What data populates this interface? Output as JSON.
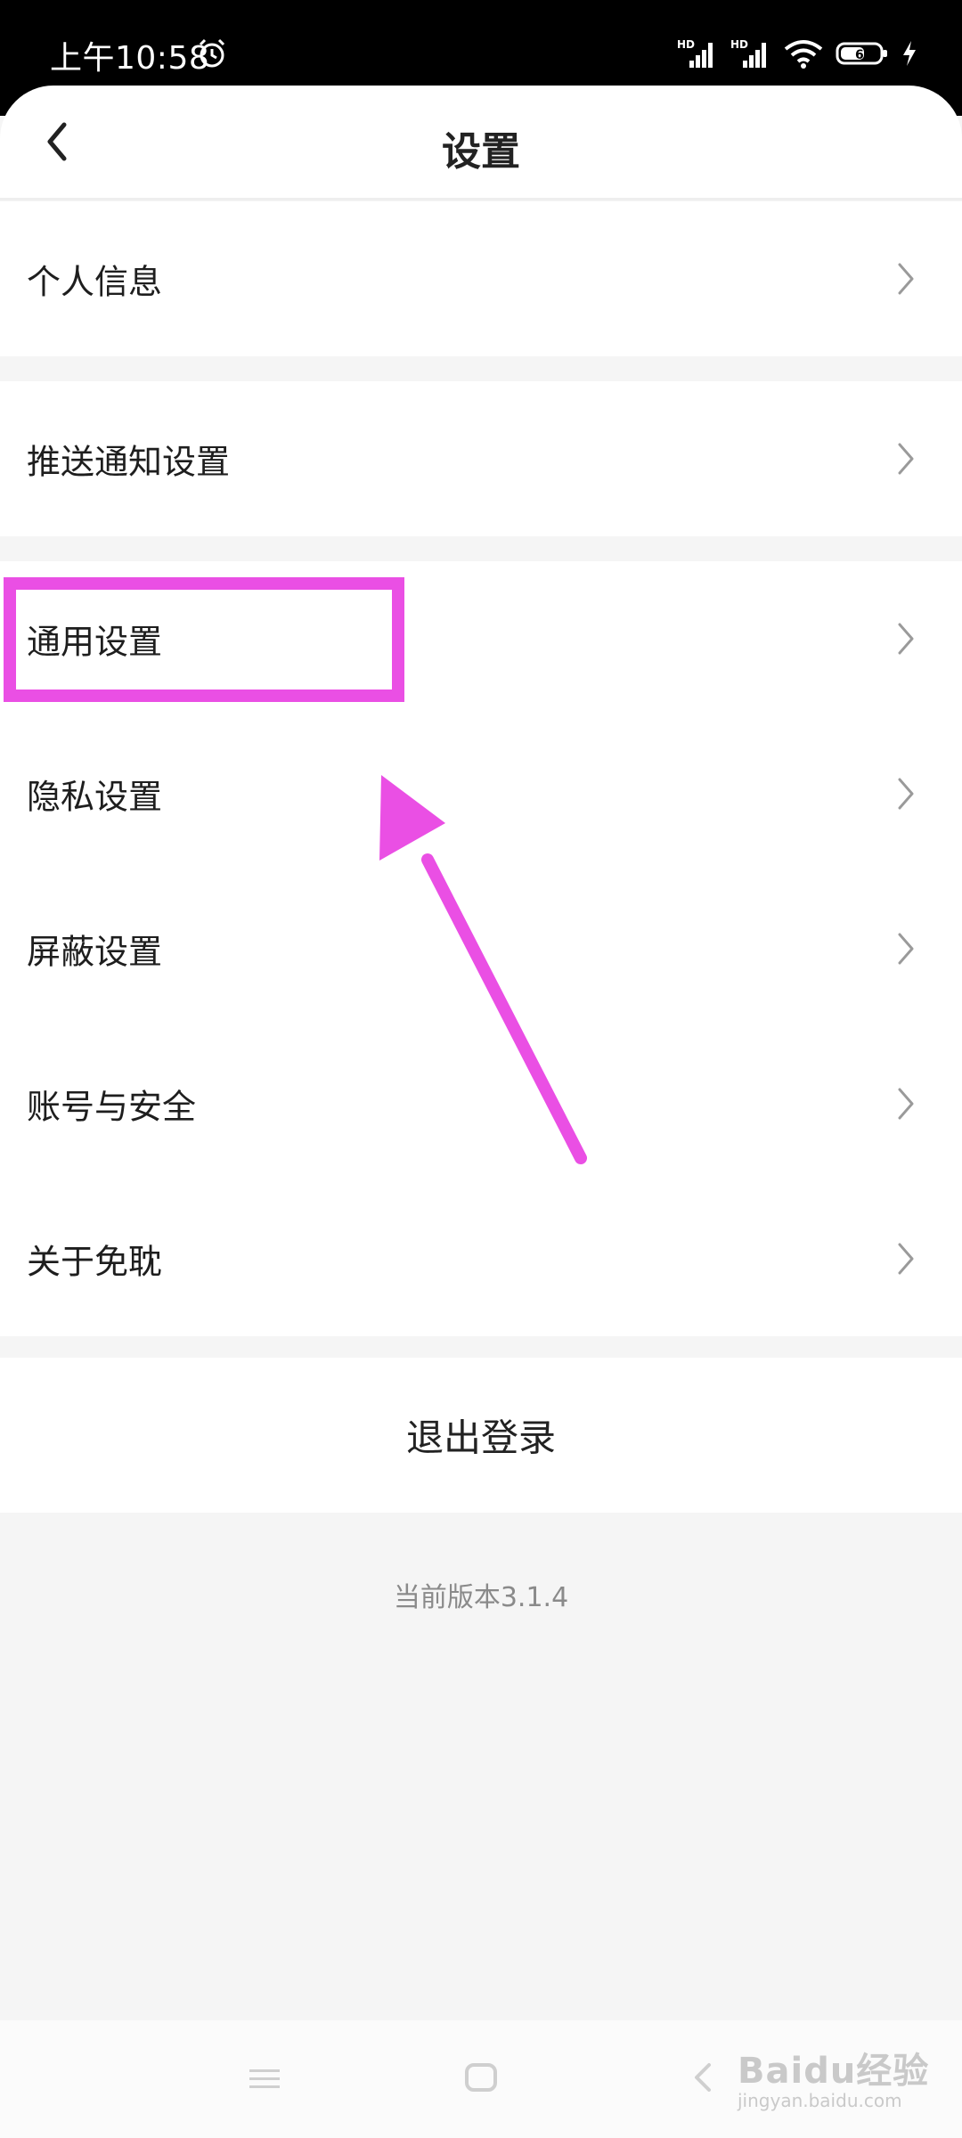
{
  "status_bar": {
    "time": "上午10:58",
    "icons": [
      "alarm-icon",
      "hd-signal-icon",
      "hd-signal-icon",
      "wifi-icon",
      "battery-icon",
      "charging-icon"
    ],
    "battery_level": "61",
    "sim1_label": "HD",
    "sim2_label": "HD"
  },
  "header": {
    "title": "设置",
    "back_icon": "chevron-left-icon"
  },
  "groups": [
    {
      "items": [
        {
          "label": "个人信息"
        }
      ]
    },
    {
      "items": [
        {
          "label": "推送通知设置"
        }
      ]
    },
    {
      "items": [
        {
          "label": "通用设置"
        },
        {
          "label": "隐私设置"
        },
        {
          "label": "屏蔽设置"
        },
        {
          "label": "账号与安全"
        },
        {
          "label": "关于免耽"
        }
      ]
    }
  ],
  "logout_label": "退出登录",
  "version_text": "当前版本3.1.4",
  "annotation": {
    "color": "#ea4fe4",
    "highlighted_item": "通用设置"
  },
  "nav_bar": {
    "icons": [
      "menu-icon",
      "home-icon",
      "back-icon"
    ]
  },
  "watermark": {
    "main": "Baidu经验",
    "sub": "jingyan.baidu.com"
  },
  "colors": {
    "page_bg": "#f5f5f5",
    "card_bg": "#ffffff",
    "text": "#222222",
    "secondary_text": "#8a8a8a"
  }
}
